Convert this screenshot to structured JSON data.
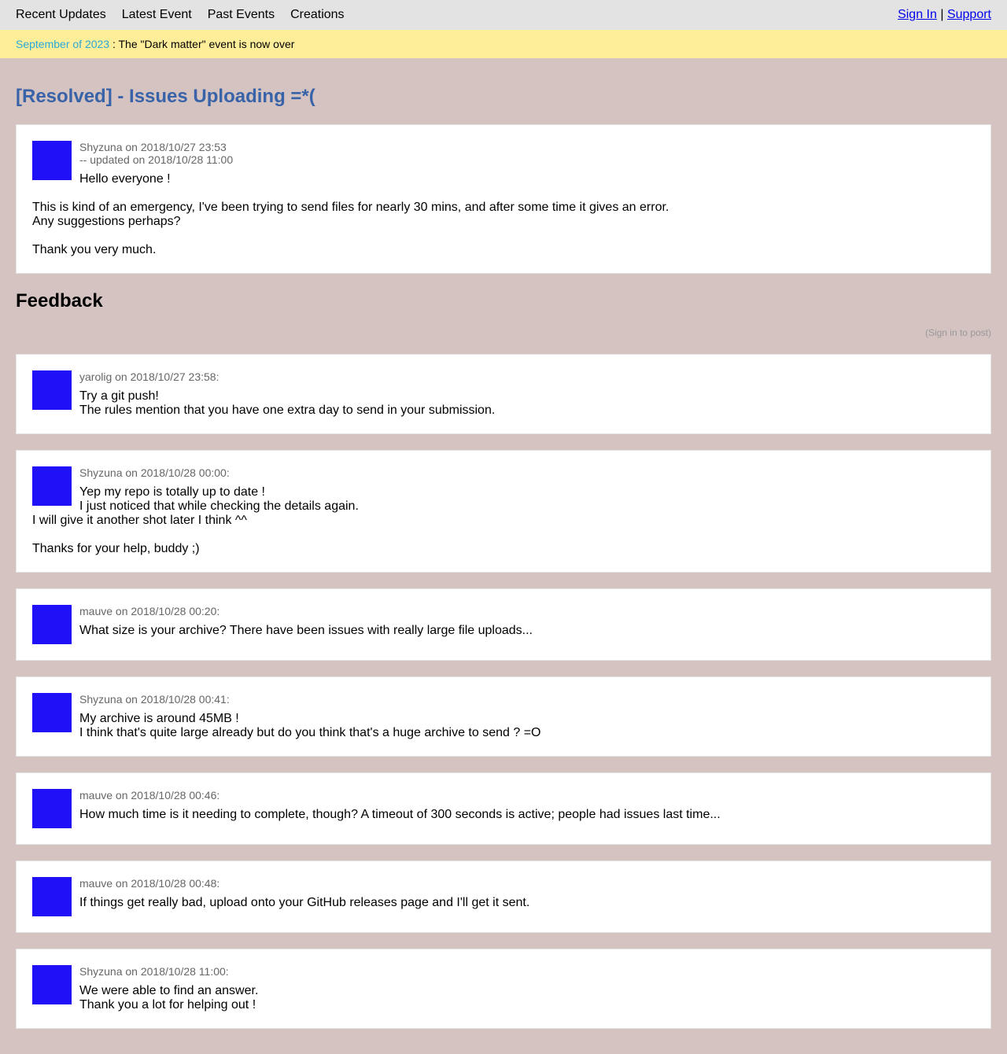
{
  "nav": {
    "links": [
      "Recent Updates",
      "Latest Event",
      "Past Events",
      "Creations"
    ],
    "sign_in": "Sign In",
    "separator": "|",
    "support": "Support"
  },
  "banner": {
    "date": "September of 2023",
    "text": " : The \"Dark matter\" event is now over"
  },
  "post": {
    "title": "[Resolved] - Issues Uploading =*(",
    "meta_line1": "Shyzuna on 2018/10/27 23:53",
    "meta_line2": "-- updated on 2018/10/28 11:00",
    "first_line": "Hello everyone !",
    "para1_line1": "This is kind of an emergency, I've been trying to send files for nearly 30 mins, and after some time it gives an error.",
    "para1_line2": "Any suggestions perhaps?",
    "para2": "Thank you very much."
  },
  "feedback": {
    "heading": "Feedback",
    "signin_note": "(Sign in to post)"
  },
  "comments": [
    {
      "meta": "yarolig on 2018/10/27 23:58:",
      "head_lines": [
        "Try a git push!",
        "The rules mention that you have one extra day to send in your submission."
      ],
      "body_blocks": []
    },
    {
      "meta": "Shyzuna on 2018/10/28 00:00:",
      "head_lines": [
        "Yep my repo is totally up to date !",
        "I just noticed that while checking the details again."
      ],
      "body_blocks": [
        [
          "I will give it another shot later I think ^^"
        ],
        [
          "Thanks for your help, buddy ;)"
        ]
      ]
    },
    {
      "meta": "mauve on 2018/10/28 00:20:",
      "head_lines": [
        "What size is your archive? There have been issues with really large file uploads..."
      ],
      "body_blocks": []
    },
    {
      "meta": "Shyzuna on 2018/10/28 00:41:",
      "head_lines": [
        "My archive is around 45MB !",
        "I think that's quite large already but do you think that's a huge archive to send ? =O"
      ],
      "body_blocks": []
    },
    {
      "meta": "mauve on 2018/10/28 00:46:",
      "head_lines": [
        "How much time is it needing to complete, though? A timeout of 300 seconds is active; people had issues last time..."
      ],
      "body_blocks": []
    },
    {
      "meta": "mauve on 2018/10/28 00:48:",
      "head_lines": [
        "If things get really bad, upload onto your GitHub releases page and I'll get it sent."
      ],
      "body_blocks": []
    },
    {
      "meta": "Shyzuna on 2018/10/28 11:00:",
      "head_lines": [
        "We were able to find an answer.",
        "Thank you a lot for helping out !"
      ],
      "body_blocks": []
    }
  ]
}
